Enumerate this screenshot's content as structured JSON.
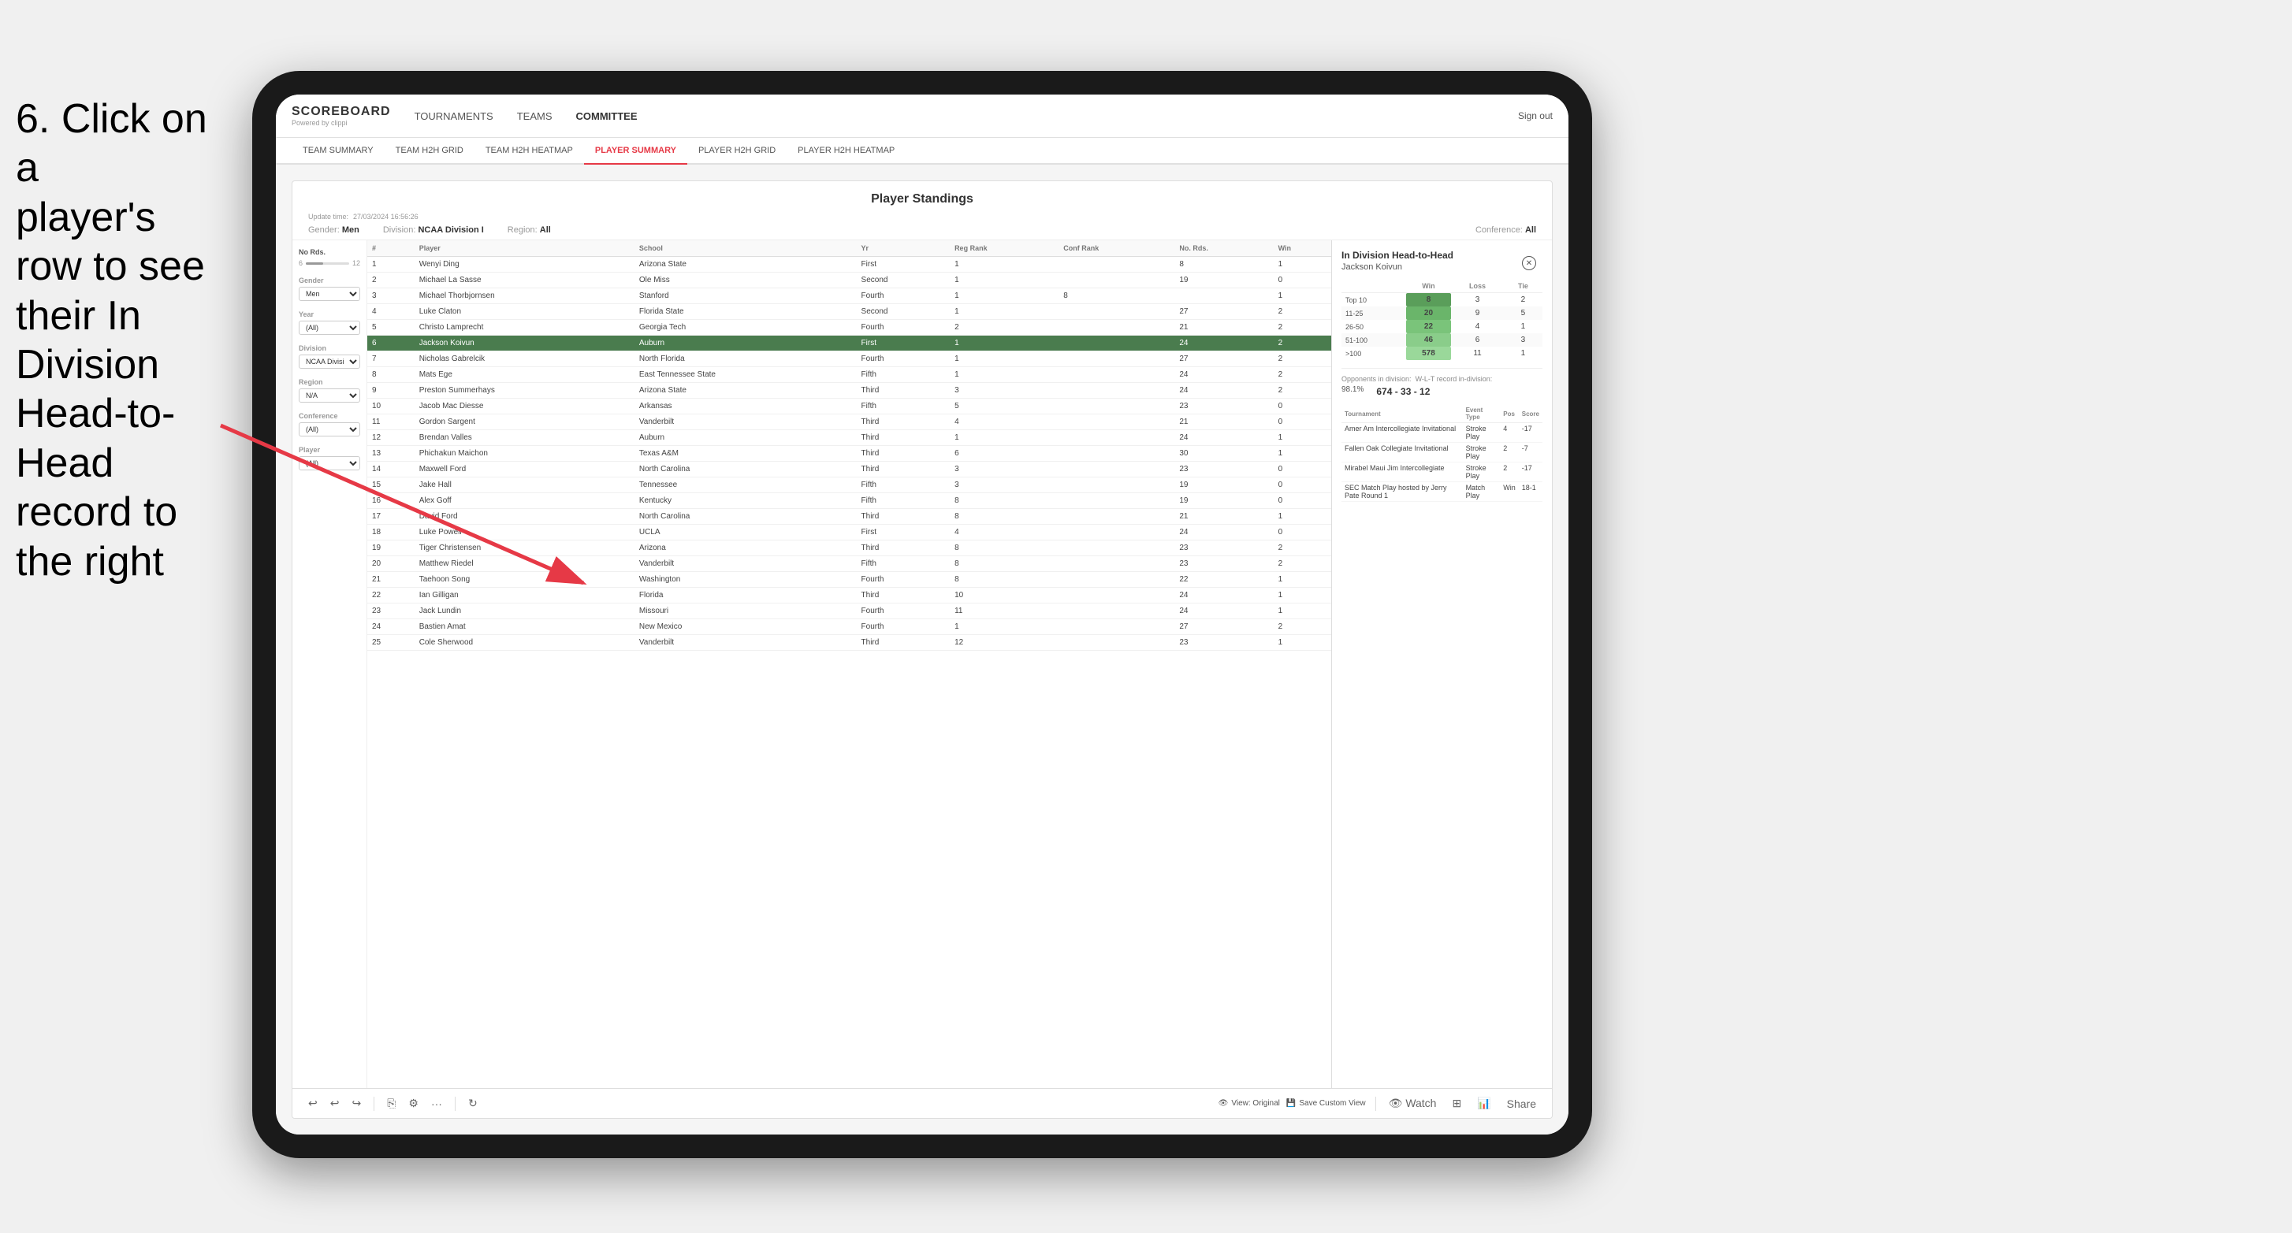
{
  "instruction": {
    "line1": "6. Click on a",
    "line2": "player's row to see",
    "line3": "their In Division",
    "line4": "Head-to-Head",
    "line5": "record to the right"
  },
  "nav": {
    "logo": "SCOREBOARD",
    "powered": "Powered by clippi",
    "items": [
      "TOURNAMENTS",
      "TEAMS",
      "COMMITTEE"
    ],
    "sign_out": "Sign out"
  },
  "sub_nav": {
    "items": [
      "TEAM SUMMARY",
      "TEAM H2H GRID",
      "TEAM H2H HEATMAP",
      "PLAYER SUMMARY",
      "PLAYER H2H GRID",
      "PLAYER H2H HEATMAP"
    ],
    "active": "PLAYER SUMMARY"
  },
  "standings": {
    "title": "Player Standings",
    "update_time": "Update time:",
    "update_date": "27/03/2024 16:56:26",
    "filters": {
      "gender_label": "Gender:",
      "gender_value": "Men",
      "division_label": "Division:",
      "division_value": "NCAA Division I",
      "region_label": "Region:",
      "region_value": "All",
      "conference_label": "Conference:",
      "conference_value": "All"
    },
    "sidebar": {
      "no_rds_label": "No Rds.",
      "slider_min": "6",
      "slider_max": "12",
      "gender_label": "Gender",
      "gender_value": "Men",
      "year_label": "Year",
      "year_value": "(All)",
      "division_label": "Division",
      "division_value": "NCAA Division I",
      "region_label": "Region",
      "region_value": "N/A",
      "conference_label": "Conference",
      "conference_value": "(All)",
      "player_label": "Player",
      "player_value": "(All)"
    },
    "table_headers": [
      "#",
      "Player",
      "School",
      "Yr",
      "Reg Rank",
      "Conf Rank",
      "No. Rds.",
      "Win"
    ],
    "rows": [
      {
        "num": "1",
        "player": "Wenyi Ding",
        "school": "Arizona State",
        "yr": "First",
        "reg": "1",
        "conf": "",
        "rds": "8",
        "win": "1",
        "selected": false
      },
      {
        "num": "2",
        "player": "Michael La Sasse",
        "school": "Ole Miss",
        "yr": "Second",
        "reg": "1",
        "conf": "",
        "rds": "19",
        "win": "0",
        "selected": false
      },
      {
        "num": "3",
        "player": "Michael Thorbjornsen",
        "school": "Stanford",
        "yr": "Fourth",
        "reg": "1",
        "conf": "8",
        "rds": "",
        "win": "1",
        "selected": false
      },
      {
        "num": "4",
        "player": "Luke Claton",
        "school": "Florida State",
        "yr": "Second",
        "reg": "1",
        "conf": "",
        "rds": "27",
        "win": "2",
        "selected": false
      },
      {
        "num": "5",
        "player": "Christo Lamprecht",
        "school": "Georgia Tech",
        "yr": "Fourth",
        "reg": "2",
        "conf": "",
        "rds": "21",
        "win": "2",
        "selected": false
      },
      {
        "num": "6",
        "player": "Jackson Koivun",
        "school": "Auburn",
        "yr": "First",
        "reg": "1",
        "conf": "",
        "rds": "24",
        "win": "2",
        "selected": true
      },
      {
        "num": "7",
        "player": "Nicholas Gabrelcik",
        "school": "North Florida",
        "yr": "Fourth",
        "reg": "1",
        "conf": "",
        "rds": "27",
        "win": "2",
        "selected": false
      },
      {
        "num": "8",
        "player": "Mats Ege",
        "school": "East Tennessee State",
        "yr": "Fifth",
        "reg": "1",
        "conf": "",
        "rds": "24",
        "win": "2",
        "selected": false
      },
      {
        "num": "9",
        "player": "Preston Summerhays",
        "school": "Arizona State",
        "yr": "Third",
        "reg": "3",
        "conf": "",
        "rds": "24",
        "win": "2",
        "selected": false
      },
      {
        "num": "10",
        "player": "Jacob Mac Diesse",
        "school": "Arkansas",
        "yr": "Fifth",
        "reg": "5",
        "conf": "",
        "rds": "23",
        "win": "0",
        "selected": false
      },
      {
        "num": "11",
        "player": "Gordon Sargent",
        "school": "Vanderbilt",
        "yr": "Third",
        "reg": "4",
        "conf": "",
        "rds": "21",
        "win": "0",
        "selected": false
      },
      {
        "num": "12",
        "player": "Brendan Valles",
        "school": "Auburn",
        "yr": "Third",
        "reg": "1",
        "conf": "",
        "rds": "24",
        "win": "1",
        "selected": false
      },
      {
        "num": "13",
        "player": "Phichakun Maichon",
        "school": "Texas A&M",
        "yr": "Third",
        "reg": "6",
        "conf": "",
        "rds": "30",
        "win": "1",
        "selected": false
      },
      {
        "num": "14",
        "player": "Maxwell Ford",
        "school": "North Carolina",
        "yr": "Third",
        "reg": "3",
        "conf": "",
        "rds": "23",
        "win": "0",
        "selected": false
      },
      {
        "num": "15",
        "player": "Jake Hall",
        "school": "Tennessee",
        "yr": "Fifth",
        "reg": "3",
        "conf": "",
        "rds": "19",
        "win": "0",
        "selected": false
      },
      {
        "num": "16",
        "player": "Alex Goff",
        "school": "Kentucky",
        "yr": "Fifth",
        "reg": "8",
        "conf": "",
        "rds": "19",
        "win": "0",
        "selected": false
      },
      {
        "num": "17",
        "player": "David Ford",
        "school": "North Carolina",
        "yr": "Third",
        "reg": "8",
        "conf": "",
        "rds": "21",
        "win": "1",
        "selected": false
      },
      {
        "num": "18",
        "player": "Luke Powell",
        "school": "UCLA",
        "yr": "First",
        "reg": "4",
        "conf": "",
        "rds": "24",
        "win": "0",
        "selected": false
      },
      {
        "num": "19",
        "player": "Tiger Christensen",
        "school": "Arizona",
        "yr": "Third",
        "reg": "8",
        "conf": "",
        "rds": "23",
        "win": "2",
        "selected": false
      },
      {
        "num": "20",
        "player": "Matthew Riedel",
        "school": "Vanderbilt",
        "yr": "Fifth",
        "reg": "8",
        "conf": "",
        "rds": "23",
        "win": "2",
        "selected": false
      },
      {
        "num": "21",
        "player": "Taehoon Song",
        "school": "Washington",
        "yr": "Fourth",
        "reg": "8",
        "conf": "",
        "rds": "22",
        "win": "1",
        "selected": false
      },
      {
        "num": "22",
        "player": "Ian Gilligan",
        "school": "Florida",
        "yr": "Third",
        "reg": "10",
        "conf": "",
        "rds": "24",
        "win": "1",
        "selected": false
      },
      {
        "num": "23",
        "player": "Jack Lundin",
        "school": "Missouri",
        "yr": "Fourth",
        "reg": "11",
        "conf": "",
        "rds": "24",
        "win": "1",
        "selected": false
      },
      {
        "num": "24",
        "player": "Bastien Amat",
        "school": "New Mexico",
        "yr": "Fourth",
        "reg": "1",
        "conf": "",
        "rds": "27",
        "win": "2",
        "selected": false
      },
      {
        "num": "25",
        "player": "Cole Sherwood",
        "school": "Vanderbilt",
        "yr": "Third",
        "reg": "12",
        "conf": "",
        "rds": "23",
        "win": "1",
        "selected": false
      }
    ]
  },
  "h2h_panel": {
    "title": "In Division Head-to-Head",
    "player_name": "Jackson Koivun",
    "table_headers": [
      "",
      "Win",
      "Loss",
      "Tie"
    ],
    "rows": [
      {
        "rank": "Top 10",
        "win": "8",
        "loss": "3",
        "tie": "2"
      },
      {
        "rank": "11-25",
        "win": "20",
        "loss": "9",
        "tie": "5"
      },
      {
        "rank": "26-50",
        "win": "22",
        "loss": "4",
        "tie": "1"
      },
      {
        "rank": "51-100",
        "win": "46",
        "loss": "6",
        "tie": "3"
      },
      {
        "rank": ">100",
        "win": "578",
        "loss": "11",
        "tie": "1"
      }
    ],
    "opponents_label": "Opponents in division:",
    "wlt_label": "W-L-T record in-division:",
    "pct": "98.1%",
    "record": "674 - 33 - 12",
    "tournaments_headers": [
      "Tournament",
      "Event Type",
      "Pos",
      "Score"
    ],
    "tournaments": [
      {
        "name": "Amer Am Intercollegiate Invitational",
        "type": "Stroke Play",
        "pos": "4",
        "score": "-17"
      },
      {
        "name": "Fallen Oak Collegiate Invitational",
        "type": "Stroke Play",
        "pos": "2",
        "score": "-7"
      },
      {
        "name": "Mirabel Maui Jim Intercollegiate",
        "type": "Stroke Play",
        "pos": "2",
        "score": "-17"
      },
      {
        "name": "SEC Match Play hosted by Jerry Pate Round 1",
        "type": "Match Play",
        "pos": "Win",
        "score": "18-1"
      }
    ]
  },
  "toolbar": {
    "view_original": "View: Original",
    "save_custom": "Save Custom View",
    "watch": "Watch",
    "share": "Share"
  }
}
